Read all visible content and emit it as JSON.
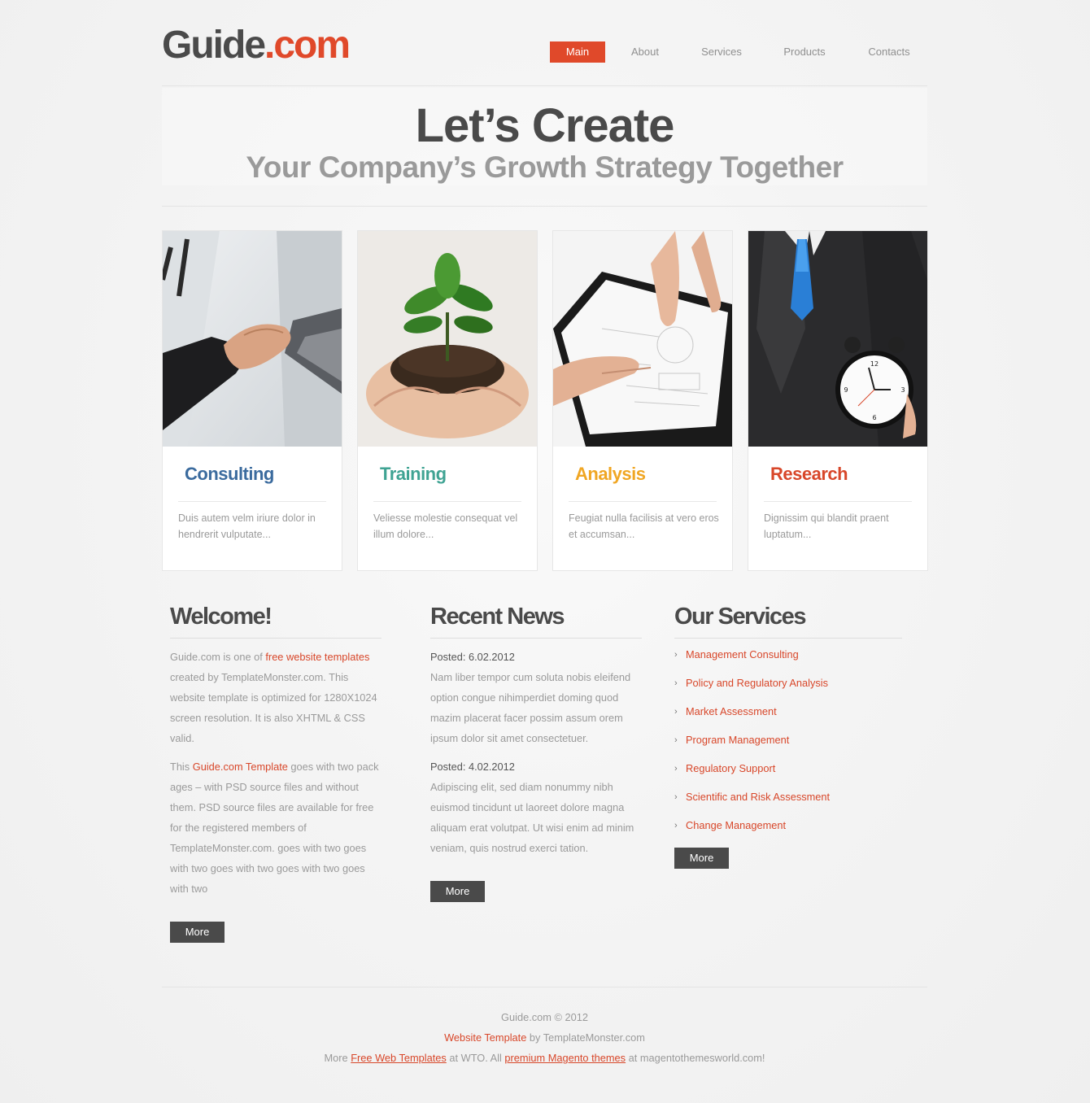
{
  "header": {
    "logo_part1": "Guide",
    "logo_part2": ".com",
    "nav": [
      {
        "label": "Main",
        "active": true
      },
      {
        "label": "About",
        "active": false
      },
      {
        "label": "Services",
        "active": false
      },
      {
        "label": "Products",
        "active": false
      },
      {
        "label": "Contacts",
        "active": false
      }
    ]
  },
  "hero": {
    "title": "Let’s Create",
    "subtitle": "Your Company’s Growth Strategy Together"
  },
  "cards": [
    {
      "title": "Consulting",
      "color": "#3b6b9e",
      "text": "Duis autem velm iriure dolor in hendrerit vulputate...",
      "image": "handshake"
    },
    {
      "title": "Training",
      "color": "#3fa393",
      "text": "Veliesse molestie consequat vel illum dolore...",
      "image": "plant-in-hands"
    },
    {
      "title": "Analysis",
      "color": "#f0a623",
      "text": "Feugiat nulla facilisis at vero eros et accumsan...",
      "image": "document-analysis"
    },
    {
      "title": "Research",
      "color": "#d8472a",
      "text": "Dignissim qui blandit praent luptatum...",
      "image": "businessman-alarm-clock"
    }
  ],
  "welcome": {
    "heading": "Welcome!",
    "p1_pre": "Guide.com is one of ",
    "p1_link": "free website templates",
    "p1_post": " created by TemplateMonster.com. This website template is optimized for 1280X1024 screen resolution. It is also XHTML & CSS valid.",
    "p2_pre": "This ",
    "p2_link": "Guide.com Template",
    "p2_post": " goes with two pack ages – with PSD source files and without them. PSD source files are available for free for the registered members of TemplateMonster.com. goes with two goes with two goes with two goes with two goes with two",
    "more": "More"
  },
  "news": {
    "heading": "Recent News",
    "items": [
      {
        "posted": "Posted: 6.02.2012",
        "text": "Nam liber tempor cum soluta nobis eleifend option congue nihimperdiet doming quod mazim placerat facer possim assum orem ipsum dolor sit amet consectetuer."
      },
      {
        "posted": "Posted: 4.02.2012",
        "text": "Adipiscing elit, sed diam nonummy nibh euismod tincidunt ut laoreet dolore magna aliquam erat volutpat. Ut wisi enim ad minim veniam, quis nostrud exerci tation."
      }
    ],
    "more": "More"
  },
  "services": {
    "heading": "Our Services",
    "items": [
      "Management Consulting",
      "Policy and Regulatory Analysis",
      "Market Assessment",
      "Program Management",
      "Regulatory Support",
      "Scientific and Risk Assessment",
      "Change Management"
    ],
    "more": "More"
  },
  "footer": {
    "line1": "Guide.com © 2012",
    "line2_link": "Website Template",
    "line2_post": " by TemplateMonster.com",
    "line3_pre": "More ",
    "line3_link1": "Free Web Templates",
    "line3_mid": " at WTO. All ",
    "line3_link2": "premium Magento themes",
    "line3_post": " at magentothemesworld.com!"
  },
  "colors": {
    "accent": "#e0492a",
    "dark": "#4a4a4a",
    "muted": "#9a9a9a"
  }
}
